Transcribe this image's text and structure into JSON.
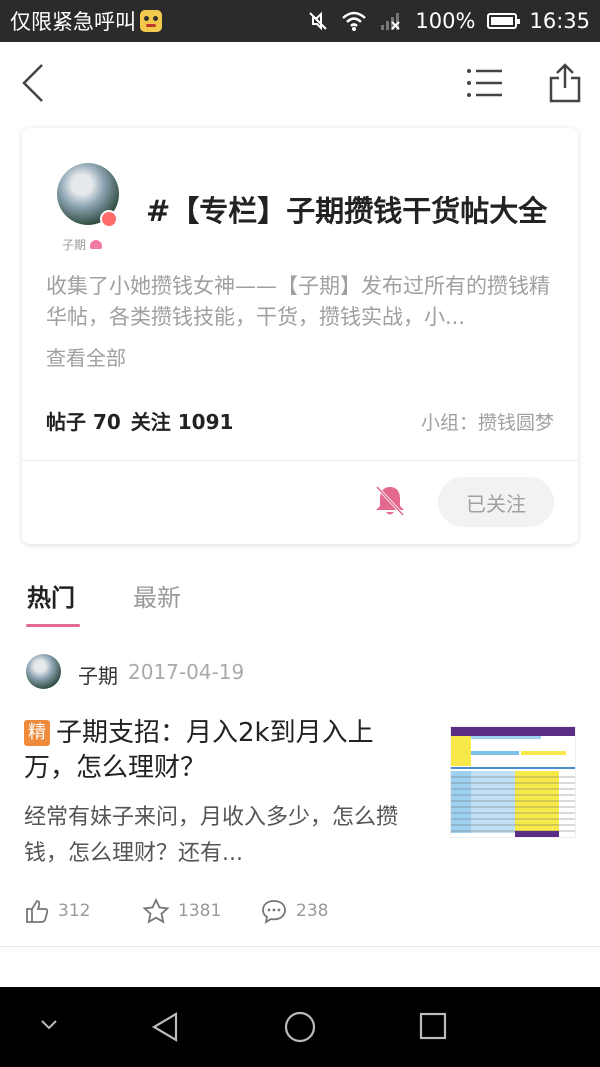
{
  "status_bar": {
    "carrier_text": "仅限紧急呼叫",
    "battery": "100%",
    "time": "16:35",
    "icons": [
      "app-emoji-icon",
      "mute-icon",
      "wifi-icon",
      "signal-icon",
      "battery-icon"
    ]
  },
  "nav": {
    "icons": [
      "back-icon",
      "list-icon",
      "share-icon"
    ]
  },
  "topic": {
    "title": "#【专栏】子期攒钱干货帖大全",
    "avatar_caption": "子期",
    "description": "收集了小她攒钱女神——【子期】发布过所有的攒钱精华帖，各类攒钱技能，干货，攒钱实战，小...",
    "see_all": "查看全部",
    "posts_label": "帖子 70",
    "follows_label": "关注 1091",
    "group_label": "小组：攒钱圆梦",
    "follow_button": "已关注"
  },
  "tabs": [
    {
      "label": "热门",
      "active": true
    },
    {
      "label": "最新",
      "active": false
    }
  ],
  "post": {
    "author": "子期",
    "date": "2017-04-19",
    "badge": "精",
    "title": "子期支招：月入2k到月入上万，怎么理财？",
    "excerpt": "经常有妹子来问，月收入多少，怎么攒钱，怎么理财？还有...",
    "likes": "312",
    "favorites": "1381",
    "comments": "238"
  },
  "colors": {
    "accent": "#e36a8e",
    "badge": "#f08a3c",
    "status_bar": "#2b2b2b"
  }
}
